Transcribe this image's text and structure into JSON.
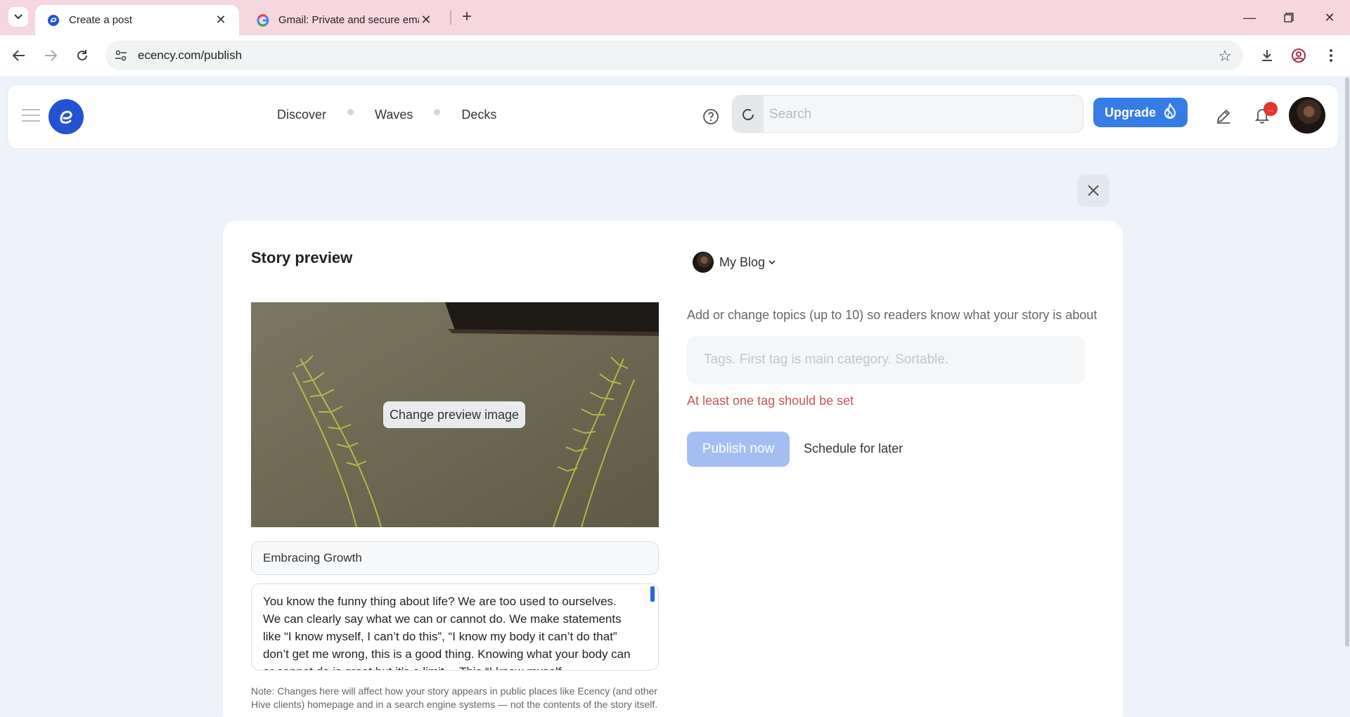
{
  "browser": {
    "tabs": [
      {
        "title": "Create a post",
        "active": true
      },
      {
        "title": "Gmail: Private and secure email",
        "active": false
      }
    ],
    "url": "ecency.com/publish"
  },
  "navbar": {
    "links": [
      "Discover",
      "Waves",
      "Decks"
    ],
    "search_placeholder": "Search",
    "upgrade_label": "Upgrade",
    "notification_badge": "..."
  },
  "editor": {
    "heading": "Story preview",
    "change_image_label": "Change preview image",
    "post_title": "Embracing Growth",
    "post_body": "You know the funny thing about life? We are too used to ourselves. We can clearly say what we can or cannot do. We make statements like “I know myself, I can’t do this”, “I know my body it can’t do that” don’t get me wrong, this is a good thing. Knowing what your body can or cannot do is great but it’s a limit… This “I know myself…",
    "note": "Note: Changes here will affect how your story appears in public places like Ecency (and other Hive clients) homepage and in a search engine systems — not the contents of the story itself."
  },
  "publish": {
    "blog_label": "My Blog",
    "topics_label": "Add or change topics (up to 10) so readers know what your story is about",
    "tags_placeholder": "Tags. First tag is main category. Sortable.",
    "tag_error": "At least one tag should be set",
    "publish_label": "Publish now",
    "schedule_label": "Schedule for later"
  },
  "colors": {
    "accent": "#357ce6",
    "logo": "#2353d3",
    "error": "#c75655",
    "tab_strip": "#f6d7df"
  }
}
